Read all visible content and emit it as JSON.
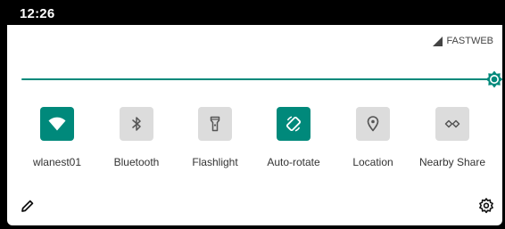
{
  "status_bar": {
    "time": "12:26"
  },
  "carrier": {
    "name": "FASTWEB",
    "icon": "signal-icon"
  },
  "brightness": {
    "level": 1.0,
    "icon": "brightness-icon",
    "color": "#00897b"
  },
  "tiles": [
    {
      "label": "wlanest01",
      "icon": "wifi-icon",
      "active": true
    },
    {
      "label": "Bluetooth",
      "icon": "bluetooth-icon",
      "active": false
    },
    {
      "label": "Flashlight",
      "icon": "flashlight-icon",
      "active": false
    },
    {
      "label": "Auto-rotate",
      "icon": "auto-rotate-icon",
      "active": true
    },
    {
      "label": "Location",
      "icon": "location-icon",
      "active": false
    },
    {
      "label": "Nearby Share",
      "icon": "nearby-share-icon",
      "active": false
    }
  ],
  "footer": {
    "edit_icon": "pencil-icon",
    "settings_icon": "gear-icon"
  },
  "colors": {
    "accent": "#00897b",
    "tile_off": "#dcdcdc",
    "icon_off": "#555555"
  }
}
